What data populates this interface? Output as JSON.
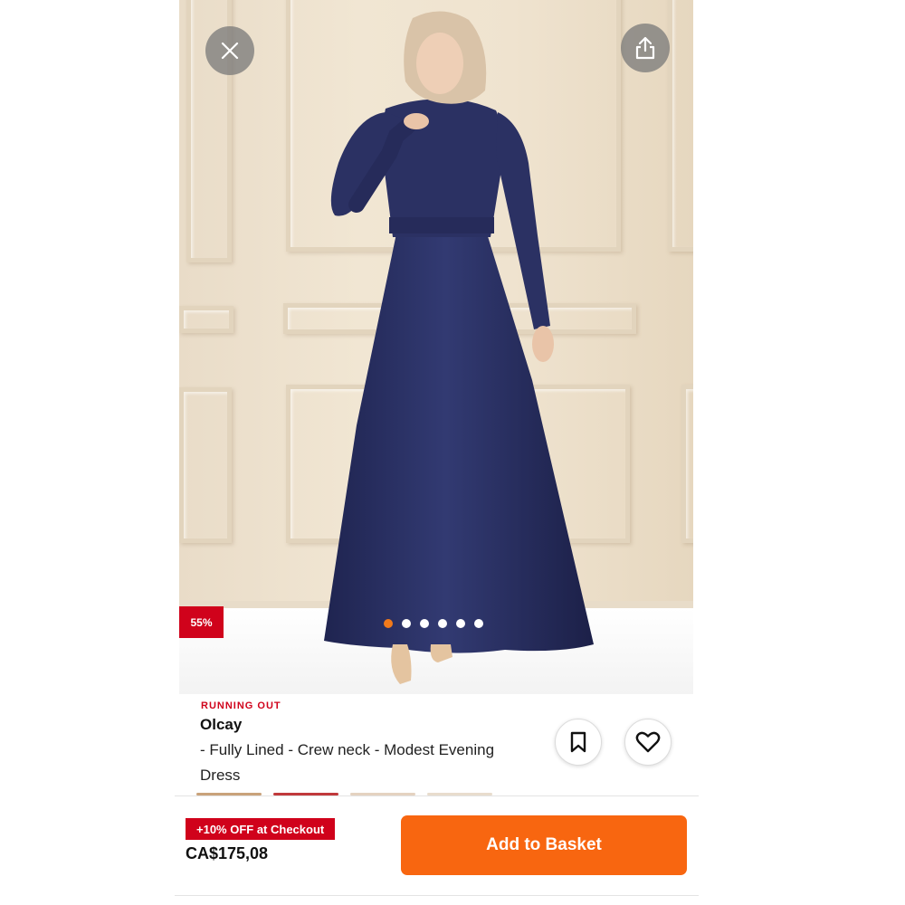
{
  "gallery": {
    "discount_badge": "55%",
    "image_count": 6,
    "active_image_index": 0,
    "close_icon": "close-icon",
    "share_icon": "share-icon"
  },
  "product": {
    "stock_status": "RUNNING OUT",
    "brand": "Olcay",
    "name": " - Fully Lined - Crew neck - Modest Evening Dress"
  },
  "actions": {
    "save_icon": "bookmark-icon",
    "favorite_icon": "heart-icon"
  },
  "footer": {
    "promo": "+10% OFF at Checkout",
    "price": "CA$175,08",
    "add_to_basket": "Add to Basket"
  },
  "colors": {
    "accent": "#f86610",
    "sale": "#d0021b",
    "dress": "#2a2f5e"
  }
}
